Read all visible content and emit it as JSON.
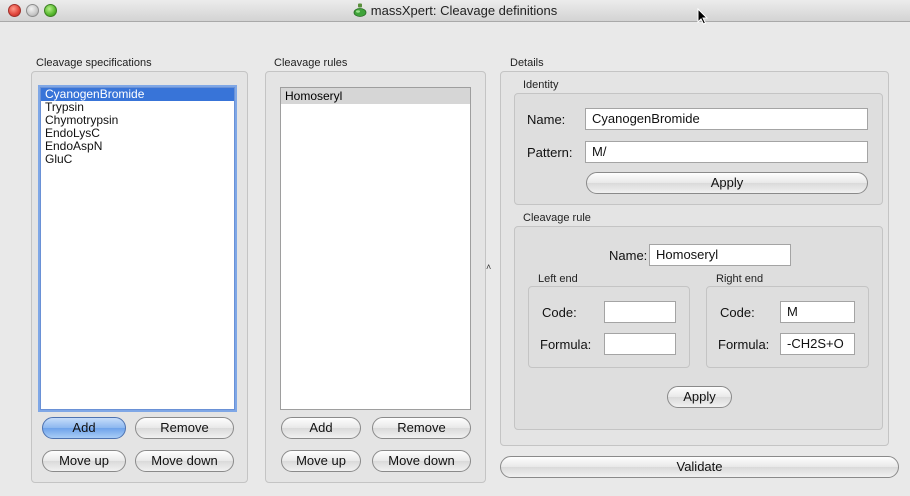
{
  "window": {
    "title": "massXpert: Cleavage definitions",
    "icons": {
      "app": "flask-icon",
      "cursor": "arrow-cursor-icon"
    }
  },
  "specifications": {
    "label": "Cleavage specifications",
    "items": [
      "CyanogenBromide",
      "Trypsin",
      "Chymotrypsin",
      "EndoLysC",
      "EndoAspN",
      "GluC"
    ],
    "selected_index": 0,
    "buttons": {
      "add": "Add",
      "remove": "Remove",
      "move_up": "Move up",
      "move_down": "Move down"
    }
  },
  "rules": {
    "label": "Cleavage rules",
    "items": [
      "Homoseryl"
    ],
    "selected_index": 0,
    "buttons": {
      "add": "Add",
      "remove": "Remove",
      "move_up": "Move up",
      "move_down": "Move down"
    }
  },
  "details": {
    "label": "Details",
    "identity": {
      "label": "Identity",
      "name_label": "Name:",
      "name_value": "CyanogenBromide",
      "pattern_label": "Pattern:",
      "pattern_value": "M/",
      "apply": "Apply"
    },
    "cleavage_rule": {
      "label": "Cleavage rule",
      "name_label": "Name:",
      "name_value": "Homoseryl",
      "left_end": {
        "label": "Left end",
        "code_label": "Code:",
        "code_value": "",
        "formula_label": "Formula:",
        "formula_value": ""
      },
      "right_end": {
        "label": "Right end",
        "code_label": "Code:",
        "code_value": "M",
        "formula_label": "Formula:",
        "formula_value": "-CH2S+O"
      },
      "apply": "Apply"
    },
    "validate": "Validate"
  },
  "splitter_glyph": "˄",
  "colors": {
    "selection": "#3874d8",
    "default_button": "#8cb7ef",
    "close": "#e0443a",
    "zoom": "#57b82e"
  }
}
